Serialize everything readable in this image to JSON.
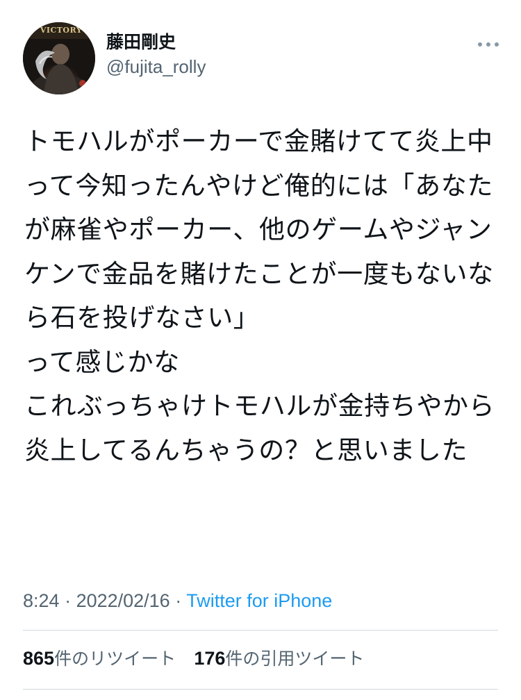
{
  "user": {
    "display_name": "藤田剛史",
    "handle": "@fujita_rolly",
    "avatar_banner_text": "VICTORY"
  },
  "tweet": {
    "text": "トモハルがポーカーで金賭けてて炎上中って今知ったんやけど俺的には「あなたが麻雀やポーカー、他のゲームやジャンケンで金品を賭けたことが一度もないなら石を投げなさい」\nって感じかな\nこれぶっちゃけトモハルが金持ちやから炎上してるんちゃうの？と思いました",
    "time": "8:24",
    "date": "2022/02/16",
    "separator": " · ",
    "source": "Twitter for iPhone"
  },
  "stats": {
    "retweets_count": "865",
    "retweets_label": "件のリツイート",
    "quotes_count": "176",
    "quotes_label": "件の引用ツイート"
  },
  "colors": {
    "text": "#0f1419",
    "secondary": "#536471",
    "link": "#1d9bf0",
    "divider": "#cfd9de"
  },
  "icons": {
    "more": "more-horizontal-icon"
  }
}
